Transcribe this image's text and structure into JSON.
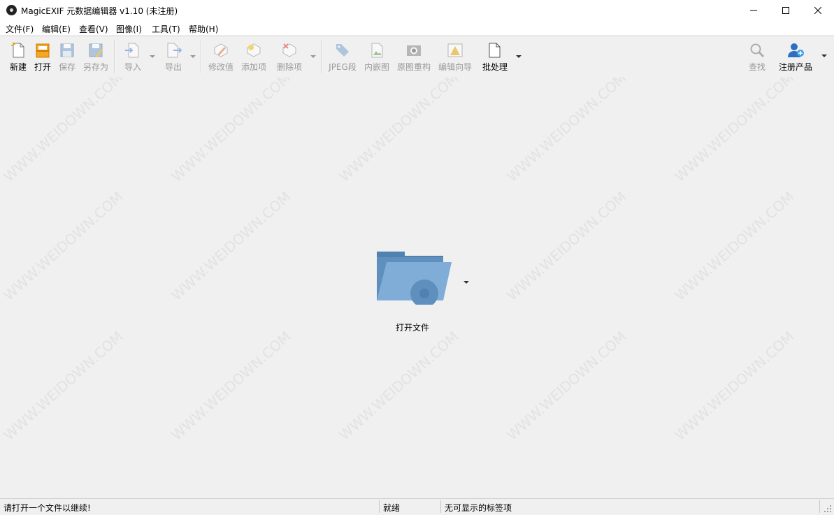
{
  "window": {
    "title": "MagicEXIF 元数据编辑器 v1.10 (未注册)"
  },
  "menu": [
    "文件(F)",
    "编辑(E)",
    "查看(V)",
    "图像(I)",
    "工具(T)",
    "帮助(H)"
  ],
  "toolbar": {
    "new": "新建",
    "open": "打开",
    "save": "保存",
    "save_as": "另存为",
    "import": "导入",
    "export": "导出",
    "modify": "修改值",
    "add": "添加项",
    "delete": "删除项",
    "jpeg": "JPEG段",
    "thumbnail": "内嵌图",
    "rebuild": "原图重构",
    "wizard": "编辑向导",
    "batch": "批处理",
    "find": "查找",
    "register": "注册产品"
  },
  "main": {
    "open_file_label": "打开文件",
    "watermark": "WWW.WEIDOWN.COM"
  },
  "status": {
    "message": "请打开一个文件以继续!",
    "state": "就绪",
    "tags": "无可显示的标签项"
  }
}
